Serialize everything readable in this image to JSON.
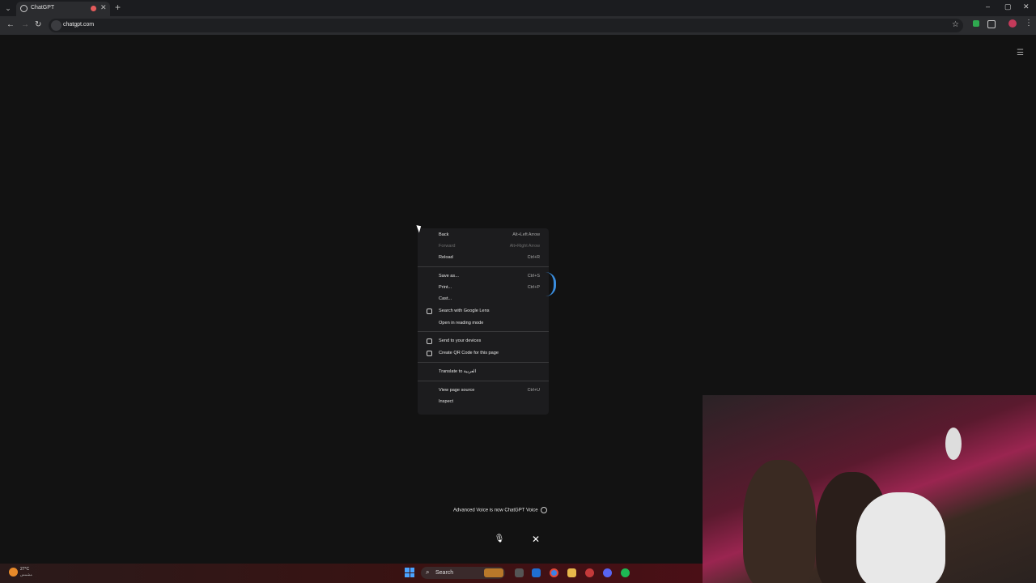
{
  "browser": {
    "tab_title": "ChatGPT",
    "url": "chatgpt.com",
    "win_controls": [
      "–",
      "▢",
      "✕"
    ]
  },
  "context_menu": {
    "items": [
      {
        "label": "Back",
        "shortcut": "Alt+Left Arrow",
        "disabled": false
      },
      {
        "label": "Forward",
        "shortcut": "Alt+Right Arrow",
        "disabled": true
      },
      {
        "label": "Reload",
        "shortcut": "Ctrl+R",
        "disabled": false
      },
      {
        "label": "Save as...",
        "shortcut": "Ctrl+S",
        "disabled": false
      },
      {
        "label": "Print...",
        "shortcut": "Ctrl+P",
        "disabled": false
      },
      {
        "label": "Cast...",
        "shortcut": "",
        "disabled": false
      },
      {
        "label": "Search with Google Lens",
        "shortcut": "",
        "disabled": false,
        "icon": "lens-icon"
      },
      {
        "label": "Open in reading mode",
        "shortcut": "",
        "disabled": false
      },
      {
        "label": "Send to your devices",
        "shortcut": "",
        "disabled": false,
        "icon": "devices-icon"
      },
      {
        "label": "Create QR Code for this page",
        "shortcut": "",
        "disabled": false,
        "icon": "qr-icon"
      },
      {
        "label": "Translate to العربية",
        "shortcut": "",
        "disabled": false
      },
      {
        "label": "View page source",
        "shortcut": "Ctrl+U",
        "disabled": false
      },
      {
        "label": "Inspect",
        "shortcut": "",
        "disabled": false
      }
    ]
  },
  "voice": {
    "notice": "Advanced Voice is now ChatGPT Voice"
  },
  "taskbar": {
    "weather_temp": "27°C",
    "weather_desc": "مشمس",
    "search_label": "Search"
  },
  "colors": {
    "accent_blue": "#3a8dde",
    "background": "#121212"
  }
}
